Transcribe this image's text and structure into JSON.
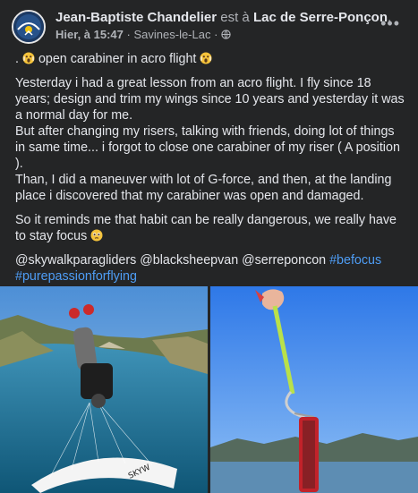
{
  "post": {
    "author": "Jean-Baptiste Chandelier",
    "est_a": "est à",
    "location": "Lac de Serre-Ponçon",
    "location_period": ".",
    "date": "Hier, à 15:47",
    "separator": "·",
    "place": "Savines-le-Lac",
    "more_label": "•••",
    "title_prefix": ". ",
    "title": "open carabiner in acro flight",
    "paragraph1": "Yesterday i had a great lesson from an acro flight. I fly since 18 years; design and trim my wings since 10 years and yesterday it was a normal day for me.",
    "paragraph1b": "But after changing my risers, talking with friends, doing lot of things in same time... i forgot to close one carabiner of my riser ( A position ).",
    "paragraph1c": "Than, I did a maneuver with lot of G-force, and then, at the landing place i discovered that my carabiner was open and damaged.",
    "paragraph2": "So it reminds me that habit can be really dangerous, we really have to stay focus",
    "mentions": "@skywalkparagliders @blacksheepvan @serreponcon",
    "hashtag1": "#befocus",
    "hashtag2": "#purepassionforflying"
  },
  "icons": {
    "scream": "scream-emoji-icon",
    "pleading": "pleading-emoji-icon",
    "globe": "globe-icon",
    "more": "more-dots-icon"
  },
  "colors": {
    "background": "#242526",
    "text": "#e4e6eb",
    "secondary": "#b0b3b8",
    "link": "#4e9df5"
  }
}
